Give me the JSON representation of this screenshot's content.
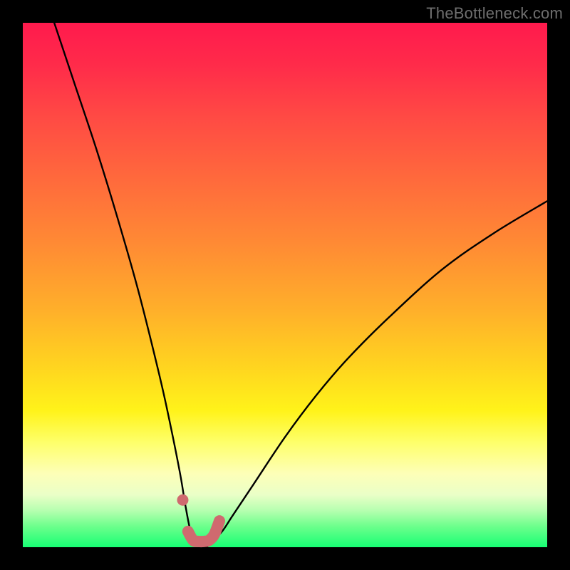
{
  "watermark": "TheBottleneck.com",
  "chart_data": {
    "type": "line",
    "title": "",
    "xlabel": "",
    "ylabel": "",
    "xlim": [
      0,
      100
    ],
    "ylim": [
      0,
      100
    ],
    "grid": false,
    "legend": false,
    "series": [
      {
        "name": "bottleneck-curve",
        "color": "#000000",
        "x": [
          6,
          10,
          14,
          18,
          22,
          26,
          28,
          30,
          31,
          32,
          33,
          34,
          35,
          36,
          38,
          40,
          44,
          50,
          56,
          62,
          70,
          80,
          90,
          100
        ],
        "values": [
          100,
          88,
          76,
          63,
          49,
          33,
          24,
          14,
          8,
          3,
          1,
          0,
          0,
          1,
          3,
          6,
          12,
          21,
          29,
          36,
          44,
          53,
          60,
          66
        ]
      },
      {
        "name": "optimal-band-marker",
        "color": "#cf6a6f",
        "x": [
          30.5,
          31.5,
          32.5,
          33.5,
          34.5,
          35.5,
          36.5,
          37.5
        ],
        "values": [
          9.0,
          3.0,
          1.3,
          1.1,
          1.1,
          1.3,
          2.4,
          5.0
        ]
      }
    ],
    "annotations": []
  }
}
